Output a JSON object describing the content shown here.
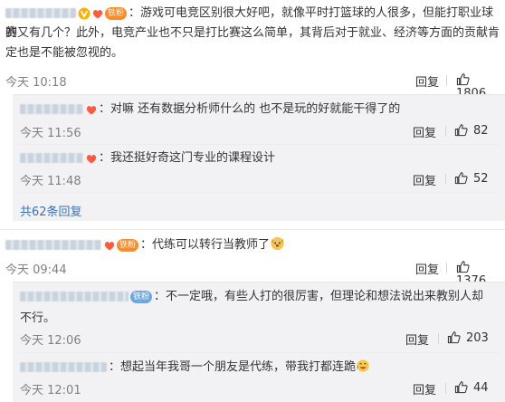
{
  "comments": [
    {
      "text_line1": "：游戏可电竞区别很大好吧，就像平时打篮球的人很多，但能打职业球赛",
      "text_line2": "的又有几个？此外，电竞产业也不只是打比赛这么简单，其背后对于就业、经济等方面的贡献肯",
      "text_line3": "定也是不能被忽视的。",
      "badge": "铁粉",
      "time": "今天 10:18",
      "reply_label": "回复",
      "likes": "1806",
      "replies": [
        {
          "text": "：对嘛 还有数据分析师什么的 也不是玩的好就能干得了的",
          "time": "今天 11:56",
          "reply_label": "回复",
          "likes": "82"
        },
        {
          "text": "：我还挺好奇这门专业的课程设计",
          "time": "今天 11:48",
          "reply_label": "回复",
          "likes": "52"
        }
      ],
      "more_replies": "共62条回复"
    },
    {
      "text": "：代练可以转行当教师了",
      "badge": "铁粉",
      "time": "今天 09:44",
      "reply_label": "回复",
      "likes": "1376",
      "replies": [
        {
          "text_line1": "：不一定哦，有些人打的很厉害，但理论和想法说出来教别人却",
          "text_line2": "不行。",
          "badge": "铁粉",
          "time": "今天 12:06",
          "reply_label": "回复",
          "likes": "203"
        },
        {
          "text": "：想起当年我哥一个朋友是代练，带我打都连跪",
          "time": "今天 12:01",
          "reply_label": "回复",
          "likes": "44"
        }
      ]
    }
  ],
  "colors": {
    "link": "#3a72b8",
    "meta": "#808080",
    "reply_bg": "#f2f2f5",
    "badge_orange": "#ff8a28",
    "badge_blue": "#6fa8dc"
  }
}
